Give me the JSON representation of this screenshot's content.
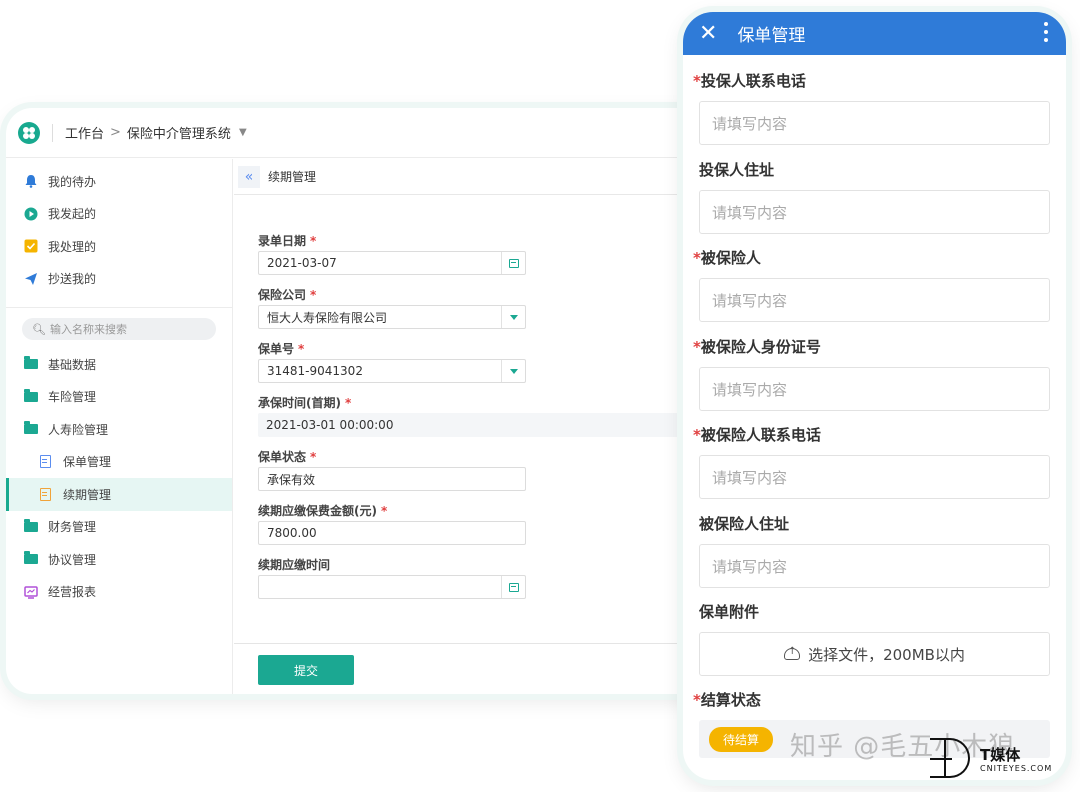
{
  "desktop": {
    "breadcrumb": {
      "home": "工作台",
      "separator": ">",
      "current": "保险中介管理系统",
      "caret": "▼"
    },
    "sidebar": {
      "top_items": [
        {
          "label": "我的待办",
          "icon": "bell-icon"
        },
        {
          "label": "我发起的",
          "icon": "play-circle-icon"
        },
        {
          "label": "我处理的",
          "icon": "check-square-icon"
        },
        {
          "label": "抄送我的",
          "icon": "send-icon"
        }
      ],
      "search_placeholder": "输入名称来搜索",
      "menu": [
        {
          "label": "基础数据",
          "icon": "folder-icon"
        },
        {
          "label": "车险管理",
          "icon": "folder-icon"
        },
        {
          "label": "人寿险管理",
          "icon": "folder-icon"
        },
        {
          "label": "保单管理",
          "icon": "document-icon",
          "sub": true
        },
        {
          "label": "续期管理",
          "icon": "document-icon",
          "sub": true,
          "active": true
        },
        {
          "label": "财务管理",
          "icon": "folder-icon"
        },
        {
          "label": "协议管理",
          "icon": "folder-icon"
        },
        {
          "label": "经营报表",
          "icon": "report-icon"
        }
      ]
    },
    "tab": {
      "collapse": "«",
      "label": "续期管理"
    },
    "form": {
      "fields": [
        {
          "label": "录单日期",
          "required": true,
          "value": "2021-03-07",
          "control": "date"
        },
        {
          "label": "保险公司",
          "required": true,
          "value": "恒大人寿保险有限公司",
          "control": "select"
        },
        {
          "label": "保单号",
          "required": true,
          "value": "31481-9041302",
          "control": "select"
        },
        {
          "label": "承保时间(首期)",
          "required": true,
          "value": "2021-03-01 00:00:00",
          "control": "readonly"
        },
        {
          "label": "保单状态",
          "required": true,
          "value": "承保有效",
          "control": "text"
        },
        {
          "label": "续期应缴保费金额(元)",
          "required": true,
          "value": "7800.00",
          "control": "text"
        },
        {
          "label": "续期应缴时间",
          "required": false,
          "value": "",
          "control": "date"
        }
      ],
      "submit_label": "提交"
    }
  },
  "mobile": {
    "header": {
      "close": "✕",
      "title": "保单管理"
    },
    "fields": [
      {
        "label": "投保人联系电话",
        "required": true,
        "placeholder": "请填写内容"
      },
      {
        "label": "投保人住址",
        "required": false,
        "placeholder": "请填写内容"
      },
      {
        "label": "被保险人",
        "required": true,
        "placeholder": "请填写内容"
      },
      {
        "label": "被保险人身份证号",
        "required": true,
        "placeholder": "请填写内容"
      },
      {
        "label": "被保险人联系电话",
        "required": true,
        "placeholder": "请填写内容"
      },
      {
        "label": "被保险人住址",
        "required": false,
        "placeholder": "请填写内容"
      }
    ],
    "attachment": {
      "label": "保单附件",
      "button": "选择文件，200MB以内"
    },
    "settlement": {
      "label": "结算状态",
      "required": true,
      "badge": "待结算"
    }
  },
  "watermark": {
    "text": "知乎 @毛五小木狼",
    "logo_text": "T媒体",
    "logo_sub": "CNITEYES.COM"
  },
  "colors": {
    "accent": "#1ba892",
    "mobile_header": "#2f7bd8",
    "required": "#e04040",
    "badge": "#f5b400"
  }
}
